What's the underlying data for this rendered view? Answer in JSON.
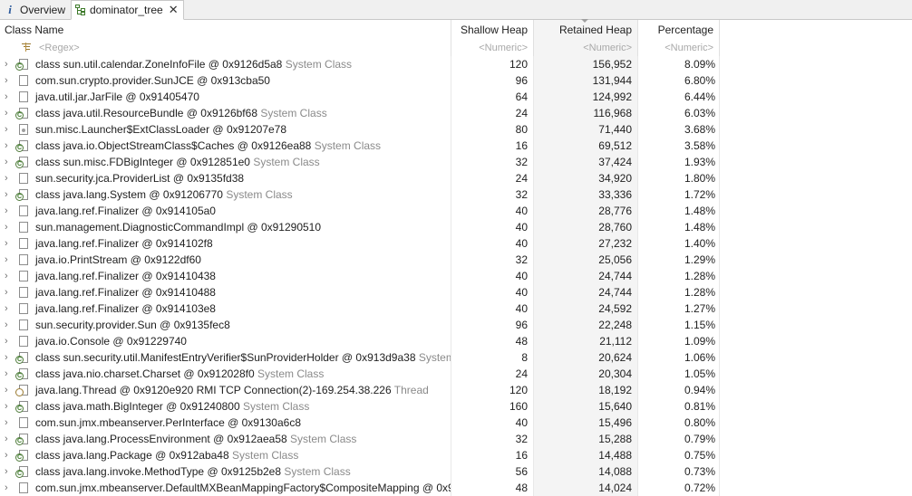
{
  "tabs": {
    "overview": "Overview",
    "dominator": "dominator_tree"
  },
  "columns": {
    "name": "Class Name",
    "shallow": "Shallow Heap",
    "retained": "Retained Heap",
    "percentage": "Percentage"
  },
  "filters": {
    "name": "<Regex>",
    "shallow": "<Numeric>",
    "retained": "<Numeric>",
    "percentage": "<Numeric>"
  },
  "rows": [
    {
      "name": "class sun.util.calendar.ZoneInfoFile @ 0x9126d5a8",
      "extra": "System Class",
      "shallow": "120",
      "retained": "156,952",
      "pct": "8.09%",
      "icon": "class-object-icon"
    },
    {
      "name": "com.sun.crypto.provider.SunJCE @ 0x913cba50",
      "extra": "",
      "shallow": "96",
      "retained": "131,944",
      "pct": "6.80%",
      "icon": "object-icon"
    },
    {
      "name": "java.util.jar.JarFile @ 0x91405470",
      "extra": "",
      "shallow": "64",
      "retained": "124,992",
      "pct": "6.44%",
      "icon": "object-icon"
    },
    {
      "name": "class java.util.ResourceBundle @ 0x9126bf68",
      "extra": "System Class",
      "shallow": "24",
      "retained": "116,968",
      "pct": "6.03%",
      "icon": "class-object-icon"
    },
    {
      "name": "sun.misc.Launcher$ExtClassLoader @ 0x91207e78",
      "extra": "",
      "shallow": "80",
      "retained": "71,440",
      "pct": "3.68%",
      "icon": "classloader-icon"
    },
    {
      "name": "class java.io.ObjectStreamClass$Caches @ 0x9126ea88",
      "extra": "System Class",
      "shallow": "16",
      "retained": "69,512",
      "pct": "3.58%",
      "icon": "class-object-icon"
    },
    {
      "name": "class sun.misc.FDBigInteger @ 0x912851e0",
      "extra": "System Class",
      "shallow": "32",
      "retained": "37,424",
      "pct": "1.93%",
      "icon": "class-object-icon"
    },
    {
      "name": "sun.security.jca.ProviderList @ 0x9135fd38",
      "extra": "",
      "shallow": "24",
      "retained": "34,920",
      "pct": "1.80%",
      "icon": "object-icon"
    },
    {
      "name": "class java.lang.System @ 0x91206770",
      "extra": "System Class",
      "shallow": "32",
      "retained": "33,336",
      "pct": "1.72%",
      "icon": "class-object-icon"
    },
    {
      "name": "java.lang.ref.Finalizer @ 0x914105a0",
      "extra": "",
      "shallow": "40",
      "retained": "28,776",
      "pct": "1.48%",
      "icon": "object-icon"
    },
    {
      "name": "sun.management.DiagnosticCommandImpl @ 0x91290510",
      "extra": "",
      "shallow": "40",
      "retained": "28,760",
      "pct": "1.48%",
      "icon": "object-icon"
    },
    {
      "name": "java.lang.ref.Finalizer @ 0x914102f8",
      "extra": "",
      "shallow": "40",
      "retained": "27,232",
      "pct": "1.40%",
      "icon": "object-icon"
    },
    {
      "name": "java.io.PrintStream @ 0x9122df60",
      "extra": "",
      "shallow": "32",
      "retained": "25,056",
      "pct": "1.29%",
      "icon": "object-icon"
    },
    {
      "name": "java.lang.ref.Finalizer @ 0x91410438",
      "extra": "",
      "shallow": "40",
      "retained": "24,744",
      "pct": "1.28%",
      "icon": "object-icon"
    },
    {
      "name": "java.lang.ref.Finalizer @ 0x91410488",
      "extra": "",
      "shallow": "40",
      "retained": "24,744",
      "pct": "1.28%",
      "icon": "object-icon"
    },
    {
      "name": "java.lang.ref.Finalizer @ 0x914103e8",
      "extra": "",
      "shallow": "40",
      "retained": "24,592",
      "pct": "1.27%",
      "icon": "object-icon"
    },
    {
      "name": "sun.security.provider.Sun @ 0x9135fec8",
      "extra": "",
      "shallow": "96",
      "retained": "22,248",
      "pct": "1.15%",
      "icon": "object-icon"
    },
    {
      "name": "java.io.Console @ 0x91229740",
      "extra": "",
      "shallow": "48",
      "retained": "21,112",
      "pct": "1.09%",
      "icon": "object-icon"
    },
    {
      "name": "class sun.security.util.ManifestEntryVerifier$SunProviderHolder @ 0x913d9a38",
      "extra": "System",
      "shallow": "8",
      "retained": "20,624",
      "pct": "1.06%",
      "icon": "class-object-icon"
    },
    {
      "name": "class java.nio.charset.Charset @ 0x912028f0",
      "extra": "System Class",
      "shallow": "24",
      "retained": "20,304",
      "pct": "1.05%",
      "icon": "class-object-icon"
    },
    {
      "name": "java.lang.Thread @ 0x9120e920  RMI TCP Connection(2)-169.254.38.226",
      "extra": "Thread",
      "shallow": "120",
      "retained": "18,192",
      "pct": "0.94%",
      "icon": "thread-icon"
    },
    {
      "name": "class java.math.BigInteger @ 0x91240800",
      "extra": "System Class",
      "shallow": "160",
      "retained": "15,640",
      "pct": "0.81%",
      "icon": "class-object-icon"
    },
    {
      "name": "com.sun.jmx.mbeanserver.PerInterface @ 0x9130a6c8",
      "extra": "",
      "shallow": "40",
      "retained": "15,496",
      "pct": "0.80%",
      "icon": "object-icon"
    },
    {
      "name": "class java.lang.ProcessEnvironment @ 0x912aea58",
      "extra": "System Class",
      "shallow": "32",
      "retained": "15,288",
      "pct": "0.79%",
      "icon": "class-object-icon"
    },
    {
      "name": "class java.lang.Package @ 0x912aba48",
      "extra": "System Class",
      "shallow": "16",
      "retained": "14,488",
      "pct": "0.75%",
      "icon": "class-object-icon"
    },
    {
      "name": "class java.lang.invoke.MethodType @ 0x9125b2e8",
      "extra": "System Class",
      "shallow": "56",
      "retained": "14,088",
      "pct": "0.73%",
      "icon": "class-object-icon"
    },
    {
      "name": "com.sun.jmx.mbeanserver.DefaultMXBeanMappingFactory$CompositeMapping @ 0x9",
      "extra": "",
      "shallow": "48",
      "retained": "14,024",
      "pct": "0.72%",
      "icon": "object-icon"
    }
  ],
  "colors": {
    "accent": "#3d7a2a",
    "muted_text": "#8a8a8a",
    "sorted_column_bg": "#f4f4f4"
  }
}
